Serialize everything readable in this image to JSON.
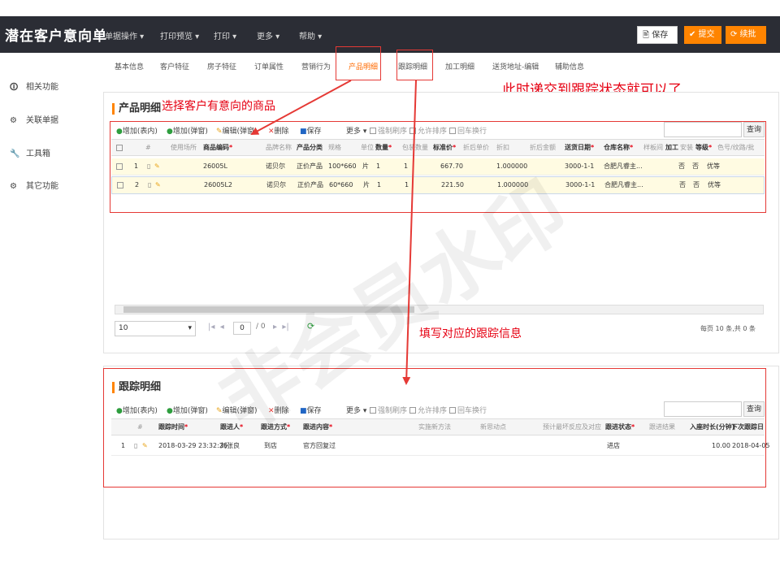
{
  "app": {
    "title": "潜在客户意向单"
  },
  "top_menu": [
    {
      "label": "单据操作 ▾"
    },
    {
      "label": "打印预览 ▾"
    },
    {
      "label": "打印 ▾"
    },
    {
      "label": "更多 ▾"
    },
    {
      "label": "帮助 ▾"
    }
  ],
  "top_buttons": {
    "save": "🖹 保存",
    "submit": "✔ 提交",
    "continue": "⟳ 续批"
  },
  "sidebar": [
    {
      "icon": "🛈",
      "label": "相关功能"
    },
    {
      "icon": "⚙",
      "label": "关联单据"
    },
    {
      "icon": "🔧",
      "label": "工具箱"
    },
    {
      "icon": "⚙",
      "label": "其它功能"
    }
  ],
  "tabs": [
    "基本信息",
    "客户特征",
    "房子特征",
    "订单属性",
    "营销行为",
    "产品明细",
    "跟踪明细",
    "加工明细",
    "送货地址-编辑",
    "辅助信息"
  ],
  "annotations": {
    "submit_note": "此时递交到跟踪状态就可以了",
    "select_product": "选择客户有意向的商品",
    "fill_tracking": "填写对应的跟踪信息",
    "watermark": "非会员水印"
  },
  "product_panel": {
    "title": "产品明细",
    "toolbar": [
      "增加(表内)",
      "增加(弹窗)",
      "编辑(弹窗)",
      "删除",
      "保存",
      "更多 ▾"
    ],
    "toolbar_checks": [
      "强制刷序",
      "允许排序",
      "回车换行"
    ],
    "query": "查询",
    "headers": [
      "#",
      "使用场所",
      "商品编码",
      "品牌名称",
      "产品分类",
      "规格",
      "单位",
      "数量",
      "包装数量",
      "标准价",
      "折后单价",
      "折扣",
      "折后金额",
      "送货日期",
      "仓库名称",
      "样板间",
      "加工",
      "安装",
      "等级",
      "色号/纹路/批"
    ],
    "rows": [
      [
        "1",
        "",
        "26005L",
        "诺贝尔",
        "正价产品",
        "100*660",
        "片",
        "1",
        "1",
        "667.70",
        "",
        "1.000000",
        "",
        "3000-1-1",
        "合肥凡睿主...",
        "",
        "否",
        "否",
        "优等",
        ""
      ],
      [
        "2",
        "",
        "26005L2",
        "诺贝尔",
        "正价产品",
        "60*660",
        "片",
        "1",
        "1",
        "221.50",
        "",
        "1.000000",
        "",
        "3000-1-1",
        "合肥凡睿主...",
        "",
        "否",
        "否",
        "优等",
        ""
      ]
    ],
    "pager": {
      "page_size": "10",
      "page_input": "0",
      "page_total": "/ 0",
      "summary": "每页 10 条,共 0 条"
    }
  },
  "tracking_panel": {
    "title": "跟踪明细",
    "toolbar": [
      "增加(表内)",
      "增加(弹窗)",
      "编辑(弹窗)",
      "删除",
      "保存",
      "更多 ▾"
    ],
    "toolbar_checks": [
      "强制刷序",
      "允许排序",
      "回车换行"
    ],
    "query": "查询",
    "headers": [
      "#",
      "跟踪时间",
      "跟进人",
      "跟进方式",
      "跟进内容",
      "实施新方法",
      "新思动点",
      "预计最坏反应及对应",
      "跟进状态",
      "跟进结果",
      "入座时长(分钟)",
      "下次跟踪日"
    ],
    "rows": [
      [
        "1",
        "2018-03-29 23:32:26",
        "刘张良",
        "到店",
        "官方回复过",
        "",
        "",
        "",
        "进店",
        "",
        "10.00",
        "2018-04-05"
      ]
    ]
  },
  "colors": {
    "topbar": "#2b2d35",
    "accent": "#ff8400",
    "annotation": "#e60012"
  }
}
